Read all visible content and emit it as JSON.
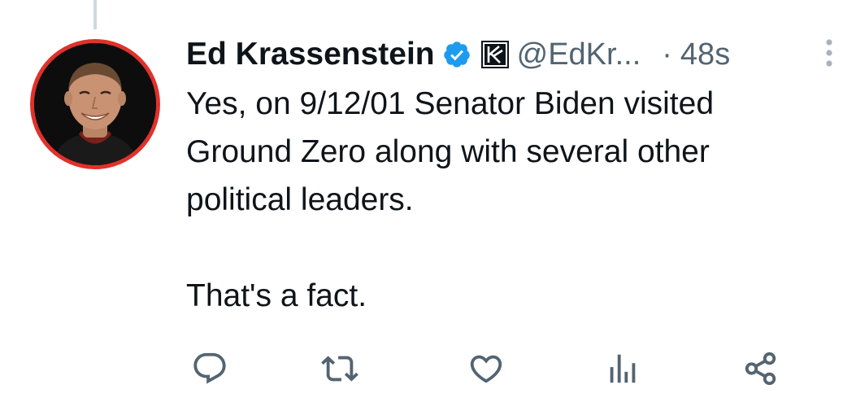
{
  "tweet": {
    "author": {
      "display_name": "Ed Krassenstein",
      "handle": "@EdKr...",
      "verified": true
    },
    "separator": "·",
    "timestamp": "48s",
    "text": "Yes, on 9/12/01 Senator Biden visited\nGround Zero along with several other\npolitical leaders.\n\nThat's a fact."
  },
  "colors": {
    "text_primary": "#0f1419",
    "text_secondary": "#536471",
    "verified_blue": "#1d9bf0",
    "avatar_ring": "#e0322b"
  },
  "icons": {
    "reply": "reply-icon",
    "retweet": "retweet-icon",
    "like": "like-icon",
    "views": "views-icon",
    "share": "share-icon",
    "more": "more-icon",
    "verified": "verified-badge-icon",
    "affiliation": "affiliation-badge-icon"
  }
}
